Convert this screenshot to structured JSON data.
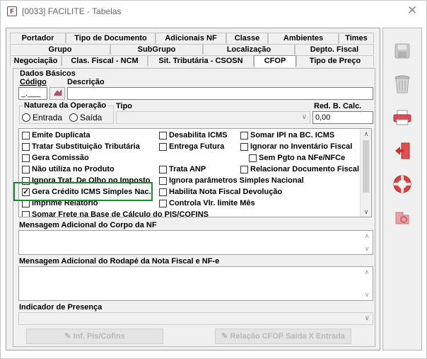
{
  "window": {
    "title": "[0033] FACILITE - Tabelas",
    "close": "✕"
  },
  "tabs": {
    "row1": [
      "Portador",
      "Tipo de Documento",
      "Adicionais NF",
      "Classe",
      "Ambientes",
      "Times"
    ],
    "row2": [
      "Grupo",
      "SubGrupo",
      "Localização",
      "Depto. Fiscal"
    ],
    "row3": [
      "Negociação",
      "Clas. Fiscal - NCM",
      "Sit. Tributária - CSOSN",
      "CFOP",
      "Tipo de Preço"
    ],
    "active": "CFOP"
  },
  "dados_basicos": {
    "label": "Dados Básicos",
    "codigo_label": "Código",
    "descricao_label": "Descrição",
    "codigo_value": "_.___",
    "descricao_value": ""
  },
  "natureza": {
    "label": "Natureza da Operação",
    "entrada": "Entrada",
    "saida": "Saída"
  },
  "tipo": {
    "label": "Tipo",
    "value": ""
  },
  "red_calc": {
    "label": "Red. B. Calc.",
    "value": "0,00"
  },
  "checkboxes": [
    {
      "label": "Emite Duplicata",
      "checked": false
    },
    {
      "label": "Desabilita ICMS",
      "checked": false
    },
    {
      "label": "Somar IPI na BC. ICMS",
      "checked": false
    },
    {
      "label": "Tratar Substituição Tributária",
      "checked": false
    },
    {
      "label": "Entrega Futura",
      "checked": false
    },
    {
      "label": "Ignorar no Inventário Fiscal",
      "checked": false
    },
    {
      "label": "Gera Comissão",
      "checked": false
    },
    {
      "label": "Sem Pgto na NFe/NFCe",
      "checked": false
    },
    {
      "label": "Não utiliza no Produto",
      "checked": false
    },
    {
      "label": "Trata ANP",
      "checked": false
    },
    {
      "label": "Relacionar Documento Fiscal",
      "checked": false
    },
    {
      "label": "Ignora Trat. De Olho no Imposto",
      "checked": false
    },
    {
      "label": "Ignora parâmetros Simples Nacional",
      "checked": false
    },
    {
      "label": "Gera Crédito ICMS Simples Nac.",
      "checked": true
    },
    {
      "label": "Habilita Nota Fiscal Devolução",
      "checked": false
    },
    {
      "label": "Imprime Relatório",
      "checked": false
    },
    {
      "label": "Controla Vlr. limite Mês",
      "checked": false
    },
    {
      "label": "Somar Frete na Base de Cálculo do PIS/COFINS",
      "checked": false
    }
  ],
  "memo_corpo": {
    "label": "Mensagem Adicional do Corpo da NF"
  },
  "memo_rodape": {
    "label": "Mensagem Adicional do Rodapé da Nota Fiscal e NF-e"
  },
  "indicador": {
    "label": "Indicador de Presença",
    "value": ""
  },
  "buttons": {
    "inf_pis": "Inf. Pis/Cofins",
    "relacao": "Relação CFOP Saída X Entrada"
  },
  "sidebar": [
    "save-icon",
    "trash-icon",
    "print-icon",
    "exit-icon",
    "help-icon",
    "settings-icon"
  ]
}
